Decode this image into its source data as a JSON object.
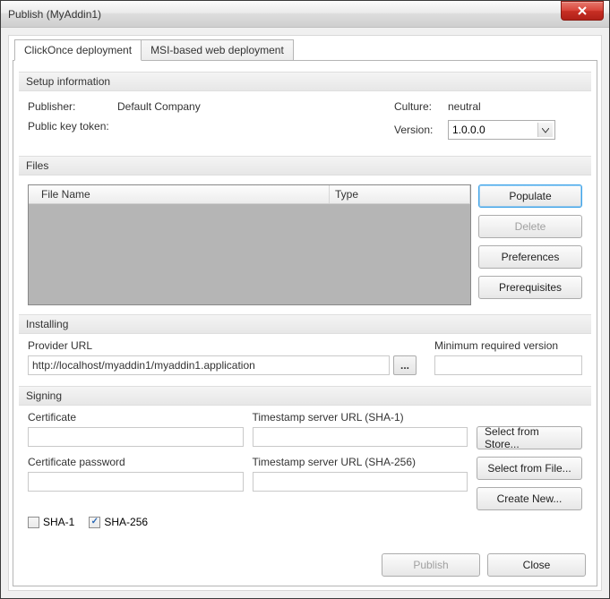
{
  "window": {
    "title": "Publish (MyAddin1)"
  },
  "tabs": {
    "clickonce": "ClickOnce deployment",
    "msi": "MSI-based web deployment"
  },
  "sections": {
    "setup": "Setup information",
    "files": "Files",
    "installing": "Installing",
    "signing": "Signing"
  },
  "setup": {
    "publisher_label": "Publisher:",
    "publisher_value": "Default Company",
    "pkt_label": "Public key token:",
    "pkt_value": "",
    "culture_label": "Culture:",
    "culture_value": "neutral",
    "version_label": "Version:",
    "version_value": "1.0.0.0"
  },
  "files": {
    "col_name": "File Name",
    "col_type": "Type",
    "buttons": {
      "populate": "Populate",
      "delete": "Delete",
      "preferences": "Preferences",
      "prerequisites": "Prerequisites"
    },
    "rows": []
  },
  "installing": {
    "provider_label": "Provider URL",
    "provider_value": "http://localhost/myaddin1/myaddin1.application",
    "browse": "...",
    "min_version_label": "Minimum required version",
    "min_version_value": ""
  },
  "signing": {
    "cert_label": "Certificate",
    "cert_value": "",
    "certpw_label": "Certificate password",
    "certpw_value": "",
    "ts1_label": "Timestamp server URL (SHA-1)",
    "ts1_value": "",
    "ts256_label": "Timestamp server URL (SHA-256)",
    "ts256_value": "",
    "select_store": "Select from Store...",
    "select_file": "Select from File...",
    "create_new": "Create New...",
    "sha1_label": "SHA-1",
    "sha256_label": "SHA-256",
    "sha1_checked": false,
    "sha256_checked": true
  },
  "footer": {
    "publish": "Publish",
    "close": "Close"
  }
}
